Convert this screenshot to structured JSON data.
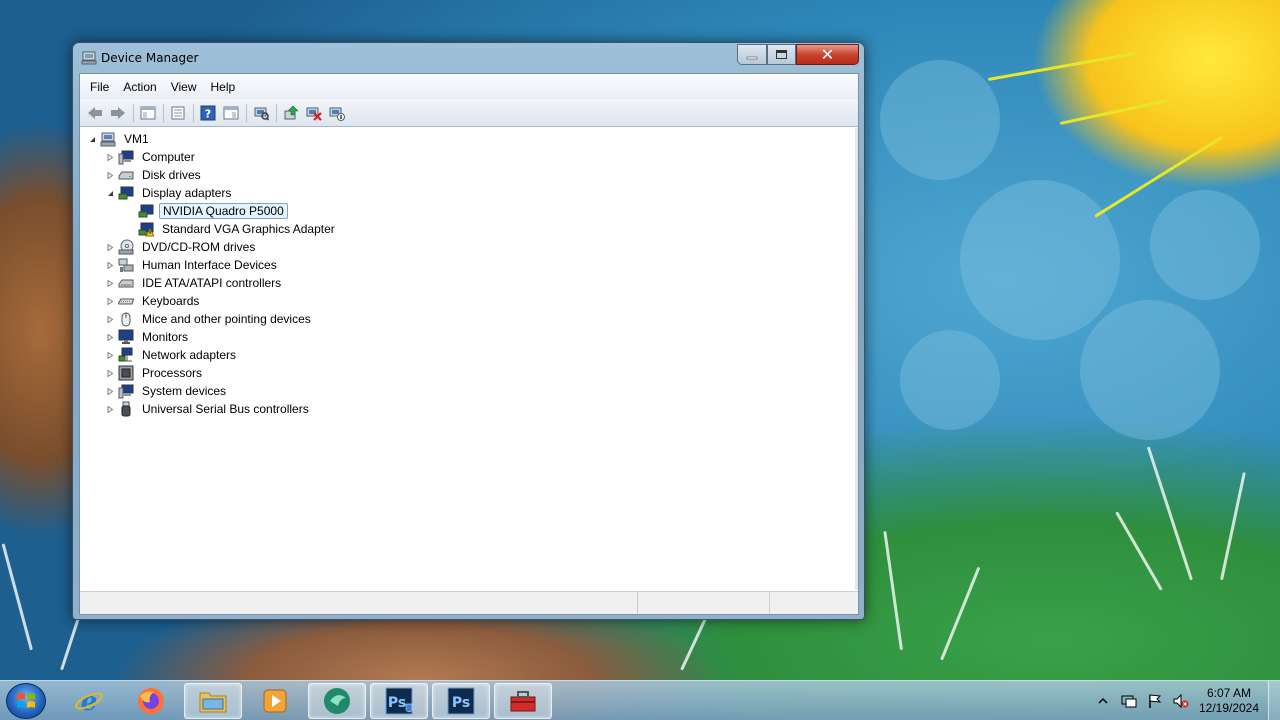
{
  "window": {
    "title": "Device Manager",
    "close_symbol": "✕"
  },
  "menu": [
    "File",
    "Action",
    "View",
    "Help"
  ],
  "toolbar_icons": [
    "back-arrow-icon",
    "forward-arrow-icon",
    "show-hide-console-tree-icon",
    "properties-icon",
    "help-icon",
    "show-action-pane-icon",
    "scan-hardware-changes-icon",
    "update-driver-icon",
    "uninstall-device-icon",
    "disable-device-icon"
  ],
  "tree": {
    "root": "VM1",
    "computer": "Computer",
    "disk_drives": "Disk drives",
    "display_adapters": "Display adapters",
    "nvidia": "NVIDIA Quadro P5000",
    "standard_vga": "Standard VGA Graphics Adapter",
    "dvd": "DVD/CD-ROM drives",
    "hid": "Human Interface Devices",
    "ide": "IDE ATA/ATAPI controllers",
    "keyboards": "Keyboards",
    "mice": "Mice and other pointing devices",
    "monitors": "Monitors",
    "network": "Network adapters",
    "processors": "Processors",
    "system": "System devices",
    "usb": "Universal Serial Bus controllers"
  },
  "taskbar": {
    "apps": [
      "internet-explorer",
      "firefox",
      "file-explorer",
      "media-player",
      "greenshot",
      "photoshop-admin",
      "photoshop",
      "toolbox"
    ],
    "active_app": "toolbox"
  },
  "clock": {
    "time": "6:07 AM",
    "date": "12/19/2024"
  },
  "colors": {
    "selection_bg": "#e5f3fb",
    "selection_border": "#7da2ce",
    "close_button": "#c8452f"
  }
}
